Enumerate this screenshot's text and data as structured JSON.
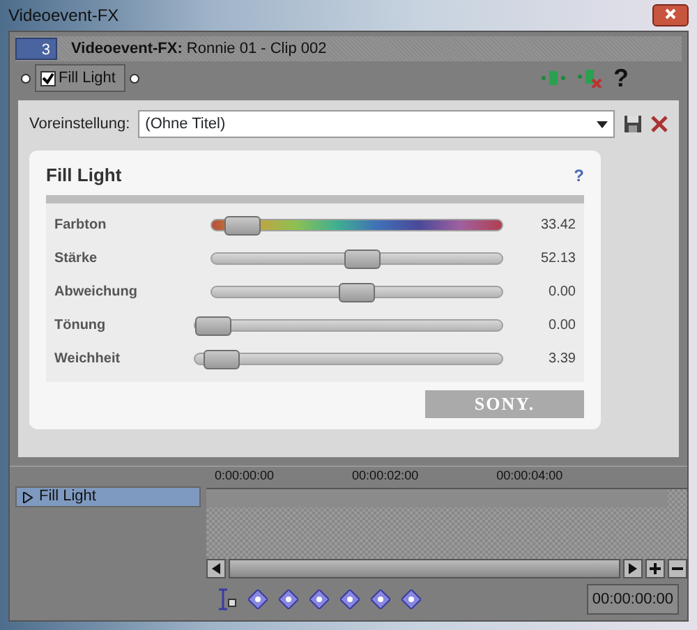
{
  "window": {
    "title": "Videoevent-FX"
  },
  "header": {
    "badge": "3",
    "title": "**Videoevent-FX:** Ronnie 01 - Clip 002"
  },
  "chain": [
    {
      "label": "Fill Light",
      "checked": true
    }
  ],
  "help": "?",
  "preset": {
    "label": "Voreinstellung:",
    "value": "(Ohne Titel)"
  },
  "plugin": {
    "title": "Fill Light",
    "help": "?",
    "logo": "SONY.",
    "sliders": [
      {
        "label": "Farbton",
        "kind": "hue",
        "level": 0.05,
        "reading": "33.42"
      },
      {
        "label": "Stärke",
        "kind": "plain",
        "level": 0.52,
        "reading": "52.13"
      },
      {
        "label": "Abweichung",
        "kind": "plain",
        "level": 0.5,
        "reading": "0.00"
      },
      {
        "label": "Tönung",
        "kind": "wide",
        "level": 0.0,
        "reading": "0.00"
      },
      {
        "label": "Weichheit",
        "kind": "wide",
        "level": 0.03,
        "reading": "3.39"
      }
    ]
  },
  "timeline": {
    "tracks": [
      {
        "label": "Fill Light",
        "selected": true,
        "expanded": false
      }
    ],
    "ruler": [
      "0:00:00:00",
      "00:00:02:00",
      "00:00:04:00"
    ],
    "timecode": "00:00:00:00"
  }
}
